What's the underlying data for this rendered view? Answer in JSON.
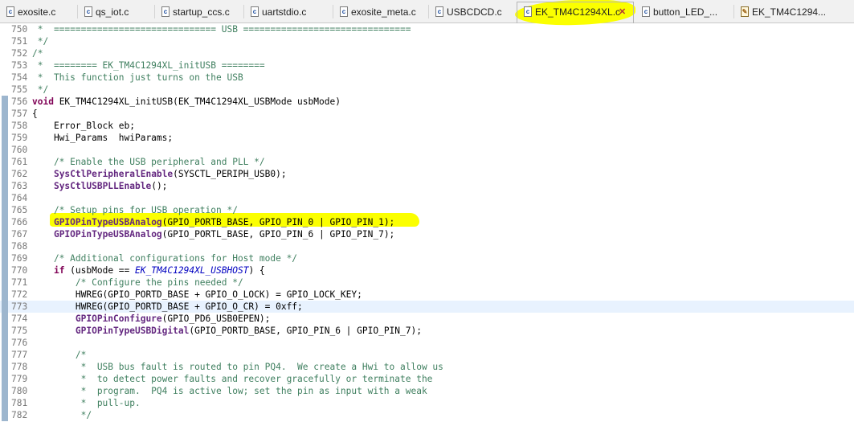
{
  "tabs": [
    {
      "label": "exosite.c",
      "icon": "c-file-icon",
      "active": false
    },
    {
      "label": "qs_iot.c",
      "icon": "c-file-icon",
      "active": false
    },
    {
      "label": "startup_ccs.c",
      "icon": "c-file-icon",
      "active": false
    },
    {
      "label": "uartstdio.c",
      "icon": "c-file-icon",
      "active": false
    },
    {
      "label": "exosite_meta.c",
      "icon": "c-file-icon",
      "active": false
    },
    {
      "label": "USBCDCD.c",
      "icon": "c-file-icon",
      "active": false
    },
    {
      "label": "EK_TM4C1294XL.c",
      "icon": "c-file-icon",
      "active": true,
      "close": "✕"
    },
    {
      "label": "button_LED_...",
      "icon": "c-file-icon",
      "active": false
    },
    {
      "label": "EK_TM4C1294...",
      "icon": "c-file-edit-icon",
      "active": false
    }
  ],
  "highlight_color": "#fbff00",
  "editor": {
    "lines": [
      {
        "n": "750",
        "text": " *  ============================== USB ==============================="
      },
      {
        "n": "751",
        "text": " */"
      },
      {
        "n": "752",
        "text": "/*"
      },
      {
        "n": "753",
        "text": " *  ======== EK_TM4C1294XL_initUSB ========"
      },
      {
        "n": "754",
        "text": " *  This function just turns on the USB"
      },
      {
        "n": "755",
        "text": " */"
      },
      {
        "n": "756",
        "text": "void EK_TM4C1294XL_initUSB(EK_TM4C1294XL_USBMode usbMode)"
      },
      {
        "n": "757",
        "text": "{"
      },
      {
        "n": "758",
        "text": "    Error_Block eb;"
      },
      {
        "n": "759",
        "text": "    Hwi_Params  hwiParams;"
      },
      {
        "n": "760",
        "text": ""
      },
      {
        "n": "761",
        "text": "    /* Enable the USB peripheral and PLL */"
      },
      {
        "n": "762",
        "text": "    SysCtlPeripheralEnable(SYSCTL_PERIPH_USB0);"
      },
      {
        "n": "763",
        "text": "    SysCtlUSBPLLEnable();"
      },
      {
        "n": "764",
        "text": ""
      },
      {
        "n": "765",
        "text": "    /* Setup pins for USB operation */"
      },
      {
        "n": "766",
        "text": "    GPIOPinTypeUSBAnalog(GPIO_PORTB_BASE, GPIO_PIN_0 | GPIO_PIN_1);"
      },
      {
        "n": "767",
        "text": "    GPIOPinTypeUSBAnalog(GPIO_PORTL_BASE, GPIO_PIN_6 | GPIO_PIN_7);"
      },
      {
        "n": "768",
        "text": ""
      },
      {
        "n": "769",
        "text": "    /* Additional configurations for Host mode */"
      },
      {
        "n": "770",
        "text": "    if (usbMode == EK_TM4C1294XL_USBHOST) {"
      },
      {
        "n": "771",
        "text": "        /* Configure the pins needed */"
      },
      {
        "n": "772",
        "text": "        HWREG(GPIO_PORTD_BASE + GPIO_O_LOCK) = GPIO_LOCK_KEY;"
      },
      {
        "n": "773",
        "text": "        HWREG(GPIO_PORTD_BASE + GPIO_O_CR) = 0xff;"
      },
      {
        "n": "774",
        "text": "        GPIOPinConfigure(GPIO_PD6_USB0EPEN);"
      },
      {
        "n": "775",
        "text": "        GPIOPinTypeUSBDigital(GPIO_PORTD_BASE, GPIO_PIN_6 | GPIO_PIN_7);"
      },
      {
        "n": "776",
        "text": ""
      },
      {
        "n": "777",
        "text": "        /*"
      },
      {
        "n": "778",
        "text": "         *  USB bus fault is routed to pin PQ4.  We create a Hwi to allow us"
      },
      {
        "n": "779",
        "text": "         *  to detect power faults and recover gracefully or terminate the"
      },
      {
        "n": "780",
        "text": "         *  program.  PQ4 is active low; set the pin as input with a weak"
      },
      {
        "n": "781",
        "text": "         *  pull-up."
      },
      {
        "n": "782",
        "text": "         */"
      }
    ]
  }
}
